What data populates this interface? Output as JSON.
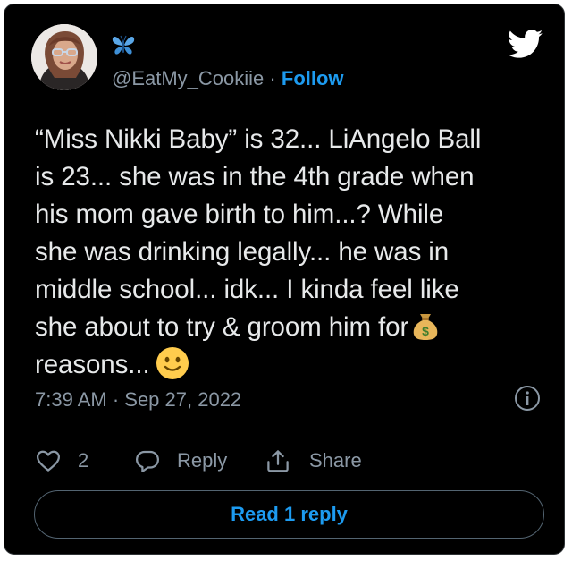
{
  "author": {
    "handle": "@EatMy_Cookiie",
    "separator": "·",
    "follow_label": "Follow",
    "avatar_icon": "avatar-photo",
    "name_icon": "blue-butterfly-emoji"
  },
  "brand": {
    "logo_icon": "twitter-bird-icon",
    "color": "#1d9bf0"
  },
  "tweet": {
    "lines": [
      "“Miss Nikki Baby” is 32... LiAngelo Ball",
      "is 23... she was in the 4th grade when",
      "his mom gave birth to him...? While",
      "she was drinking legally... he was in",
      "middle school... idk... I kinda feel like",
      "she about to try & groom him for",
      "reasons..."
    ],
    "emoji_money_bag": "money-bag-emoji",
    "emoji_smile": "slightly-smiling-face-emoji"
  },
  "meta": {
    "timestamp": "7:39 AM · Sep 27, 2022",
    "info_icon": "info-icon"
  },
  "actions": {
    "like_count": "2",
    "reply_label": "Reply",
    "share_label": "Share"
  },
  "read_replies_label": "Read 1 reply",
  "colors": {
    "background": "#000000",
    "text": "#e7e9ea",
    "secondary": "#8b98a5",
    "accent": "#1d9bf0",
    "border": "#2f3336"
  }
}
